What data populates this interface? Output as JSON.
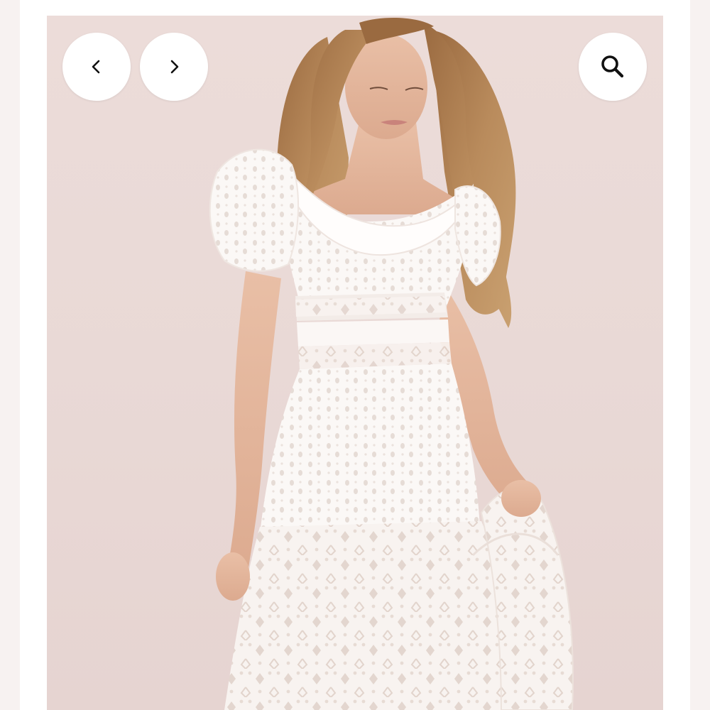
{
  "viewer": {
    "previous_icon": "chevron-left-icon",
    "next_icon": "chevron-right-icon",
    "zoom_icon": "magnifier-icon"
  },
  "colors": {
    "backdrop": "#ecdcd9",
    "button_bg": "#ffffff",
    "icon": "#111111",
    "dress": "#fbf8f6",
    "hair": "#a8774a"
  }
}
